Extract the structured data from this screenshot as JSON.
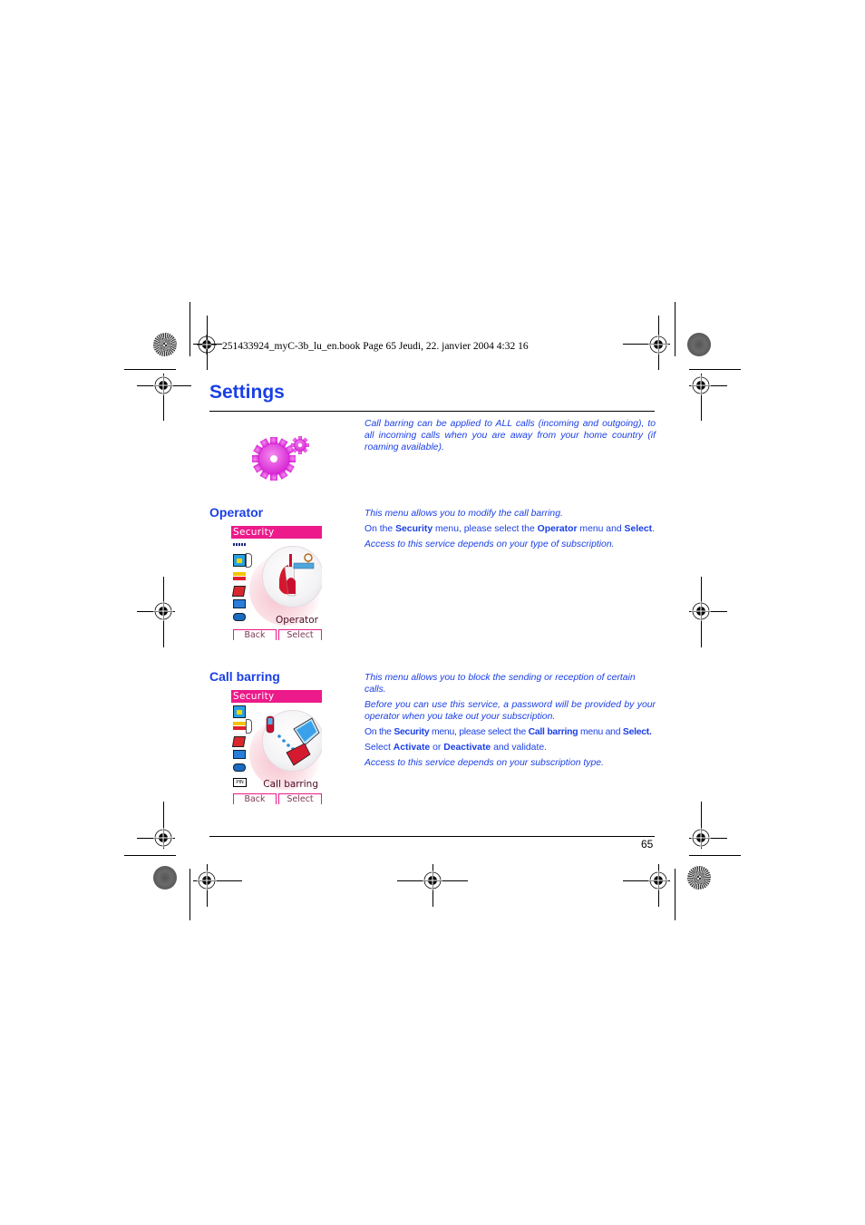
{
  "file_header": "251433924_myC-3b_lu_en.book  Page 65  Jeudi, 22. janvier 2004  4:32 16",
  "page_title": "Settings",
  "page_icon": "settings-gears-icon",
  "accent_colors": {
    "title_blue": "#1a3fe6",
    "screen_pink": "#ec1a8a",
    "gear_magenta": "#e23fe0"
  },
  "intro": "Call barring can be applied to ALL calls (incoming and outgoing), to all incoming calls when you are away from your home country (if roaming available).",
  "sections": [
    {
      "title": "Operator",
      "screen": {
        "header": "Security",
        "selected_item": "Operator",
        "softkey_left": "Back",
        "softkey_right": "Select",
        "menu_icons": [
          "wap-icon",
          "camera-card-icon",
          "arrows-icon",
          "book-icon",
          "phone-transfer-icon",
          "lock-icon"
        ]
      },
      "text": {
        "p1": "This menu allows you to modify the call barring.",
        "p2_a": "On the ",
        "p2_b": "Security",
        "p2_c": " menu, please select the ",
        "p2_d": "Operator",
        "p2_e": " menu and ",
        "p2_f": "Select",
        "p2_g": ".",
        "p3": "Access to this service depends on your type of subscription."
      }
    },
    {
      "title": "Call barring",
      "screen": {
        "header": "Security",
        "selected_item": "Call barring",
        "softkey_left": "Back",
        "softkey_right": "Select",
        "menu_icons": [
          "camera-card-icon",
          "arrows-icon",
          "book-icon",
          "phone-transfer-icon",
          "lock-icon",
          "pin-icon"
        ]
      },
      "text": {
        "p1": "This menu allows you to block the sending or reception of certain calls.",
        "p2": "Before you can use this service, a password will be provided by your operator when you take out your subscription.",
        "p3_a": "On the ",
        "p3_b": "Security",
        "p3_c": " menu, please select the ",
        "p3_d": "Call barring",
        "p3_e": " menu and ",
        "p3_f": "Select.",
        "p4_a": "Select ",
        "p4_b": "Activate",
        "p4_c": " or ",
        "p4_d": "Deactivate",
        "p4_e": " and validate.",
        "p5": "Access to this service depends on your subscription type."
      }
    }
  ],
  "page_number": "65"
}
